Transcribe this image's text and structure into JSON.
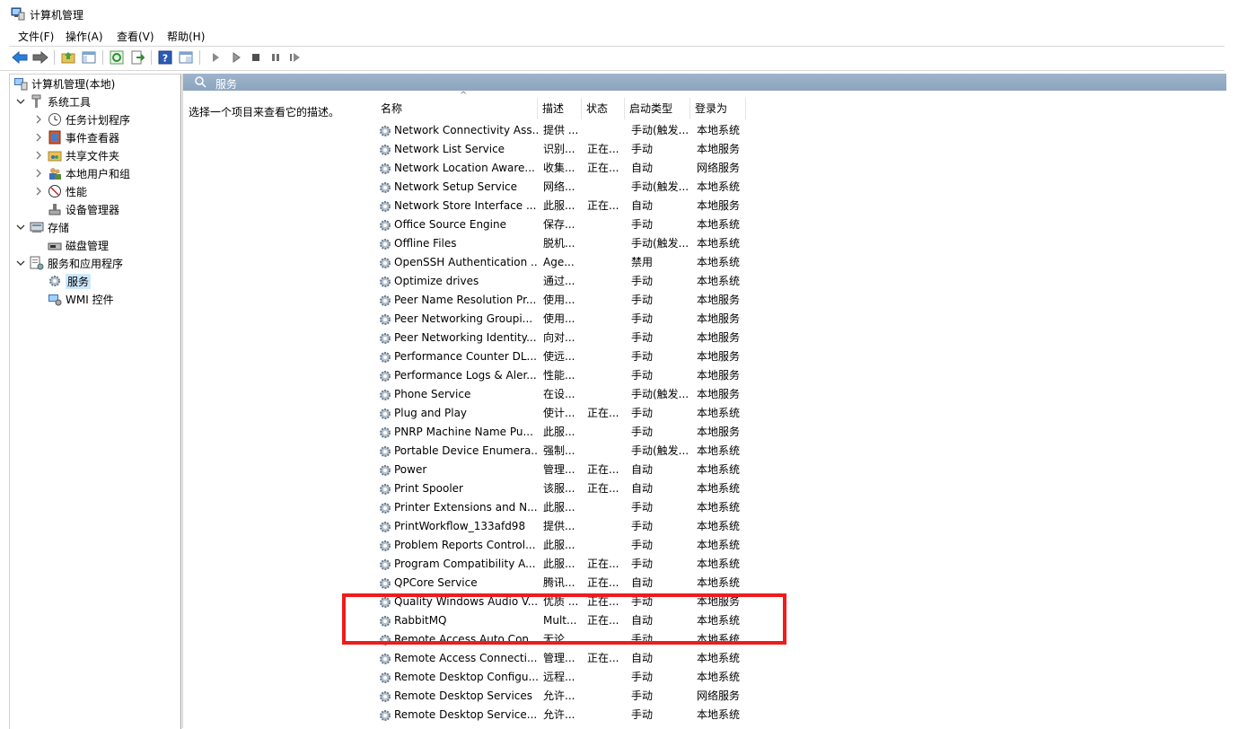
{
  "window": {
    "title": "计算机管理"
  },
  "menu": [
    "文件(F)",
    "操作(A)",
    "查看(V)",
    "帮助(H)"
  ],
  "toolbar": {
    "buttons": [
      "back-icon",
      "forward-icon",
      "up-folder-icon",
      "show-tree-icon",
      "refresh-icon",
      "export-icon",
      "help-icon",
      "properties-icon",
      "play-icon",
      "play-alt-icon",
      "stop-icon",
      "pause-icon",
      "restart-icon"
    ]
  },
  "tree": {
    "root": "计算机管理(本地)",
    "system_tools": "系统工具",
    "task_scheduler": "任务计划程序",
    "event_viewer": "事件查看器",
    "shared_folders": "共享文件夹",
    "local_users": "本地用户和组",
    "performance": "性能",
    "device_manager": "设备管理器",
    "storage": "存储",
    "disk_management": "磁盘管理",
    "services_apps": "服务和应用程序",
    "services": "服务",
    "wmi": "WMI 控件"
  },
  "pane": {
    "header": "服务",
    "description_hint": "选择一个项目来查看它的描述。"
  },
  "columns": [
    "名称",
    "描述",
    "状态",
    "启动类型",
    "登录为"
  ],
  "services": [
    {
      "name": "Network Connectivity Ass...",
      "desc": "提供 ...",
      "status": "",
      "startup": "手动(触发...",
      "logon": "本地系统"
    },
    {
      "name": "Network List Service",
      "desc": "识别...",
      "status": "正在...",
      "startup": "手动",
      "logon": "本地服务"
    },
    {
      "name": "Network Location Aware...",
      "desc": "收集...",
      "status": "正在...",
      "startup": "自动",
      "logon": "网络服务"
    },
    {
      "name": "Network Setup Service",
      "desc": "网络...",
      "status": "",
      "startup": "手动(触发...",
      "logon": "本地系统"
    },
    {
      "name": "Network Store Interface ...",
      "desc": "此服...",
      "status": "正在...",
      "startup": "自动",
      "logon": "本地服务"
    },
    {
      "name": "Office Source Engine",
      "desc": "保存...",
      "status": "",
      "startup": "手动",
      "logon": "本地系统"
    },
    {
      "name": "Offline Files",
      "desc": "脱机...",
      "status": "",
      "startup": "手动(触发...",
      "logon": "本地系统"
    },
    {
      "name": "OpenSSH Authentication ...",
      "desc": "Age...",
      "status": "",
      "startup": "禁用",
      "logon": "本地系统"
    },
    {
      "name": "Optimize drives",
      "desc": "通过...",
      "status": "",
      "startup": "手动",
      "logon": "本地系统"
    },
    {
      "name": "Peer Name Resolution Pr...",
      "desc": "使用...",
      "status": "",
      "startup": "手动",
      "logon": "本地服务"
    },
    {
      "name": "Peer Networking Groupi...",
      "desc": "使用...",
      "status": "",
      "startup": "手动",
      "logon": "本地服务"
    },
    {
      "name": "Peer Networking Identity...",
      "desc": "向对...",
      "status": "",
      "startup": "手动",
      "logon": "本地服务"
    },
    {
      "name": "Performance Counter DL...",
      "desc": "使远...",
      "status": "",
      "startup": "手动",
      "logon": "本地服务"
    },
    {
      "name": "Performance Logs & Aler...",
      "desc": "性能...",
      "status": "",
      "startup": "手动",
      "logon": "本地服务"
    },
    {
      "name": "Phone Service",
      "desc": "在设...",
      "status": "",
      "startup": "手动(触发...",
      "logon": "本地服务"
    },
    {
      "name": "Plug and Play",
      "desc": "使计...",
      "status": "正在...",
      "startup": "手动",
      "logon": "本地系统"
    },
    {
      "name": "PNRP Machine Name Pu...",
      "desc": "此服...",
      "status": "",
      "startup": "手动",
      "logon": "本地服务"
    },
    {
      "name": "Portable Device Enumera...",
      "desc": "强制...",
      "status": "",
      "startup": "手动(触发...",
      "logon": "本地系统"
    },
    {
      "name": "Power",
      "desc": "管理...",
      "status": "正在...",
      "startup": "自动",
      "logon": "本地系统"
    },
    {
      "name": "Print Spooler",
      "desc": "该服...",
      "status": "正在...",
      "startup": "自动",
      "logon": "本地系统"
    },
    {
      "name": "Printer Extensions and N...",
      "desc": "此服...",
      "status": "",
      "startup": "手动",
      "logon": "本地系统"
    },
    {
      "name": "PrintWorkflow_133afd98",
      "desc": "提供...",
      "status": "",
      "startup": "手动",
      "logon": "本地系统"
    },
    {
      "name": "Problem Reports Control...",
      "desc": "此服...",
      "status": "",
      "startup": "手动",
      "logon": "本地系统"
    },
    {
      "name": "Program Compatibility A...",
      "desc": "此服...",
      "status": "正在...",
      "startup": "手动",
      "logon": "本地系统"
    },
    {
      "name": "QPCore Service",
      "desc": "腾讯...",
      "status": "正在...",
      "startup": "自动",
      "logon": "本地系统"
    },
    {
      "name": "Quality Windows Audio V...",
      "desc": "优质 ...",
      "status": "正在...",
      "startup": "手动",
      "logon": "本地服务"
    },
    {
      "name": "RabbitMQ",
      "desc": "Mult...",
      "status": "正在...",
      "startup": "自动",
      "logon": "本地系统"
    },
    {
      "name": "Remote Access Auto Con...",
      "desc": "无论...",
      "status": "",
      "startup": "手动",
      "logon": "本地系统"
    },
    {
      "name": "Remote Access Connecti...",
      "desc": "管理...",
      "status": "正在...",
      "startup": "自动",
      "logon": "本地系统"
    },
    {
      "name": "Remote Desktop Configu...",
      "desc": "远程...",
      "status": "",
      "startup": "手动",
      "logon": "本地系统"
    },
    {
      "name": "Remote Desktop Services",
      "desc": "允许...",
      "status": "",
      "startup": "手动",
      "logon": "网络服务"
    },
    {
      "name": "Remote Desktop Service...",
      "desc": "允许...",
      "status": "",
      "startup": "手动",
      "logon": "本地系统"
    }
  ],
  "colors": {
    "header_bar": "#9fb4cc",
    "highlight": "#ee1c1c",
    "selection": "#cce8ff"
  }
}
